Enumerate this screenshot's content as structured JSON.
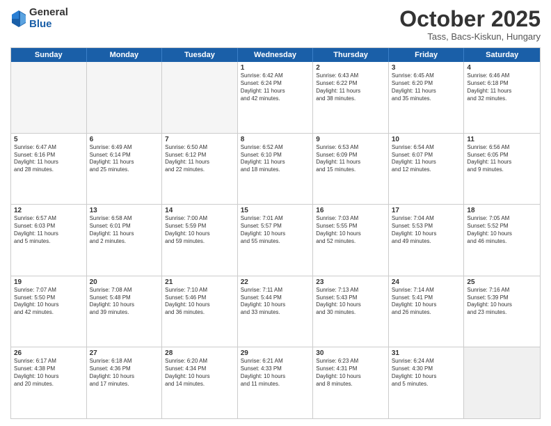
{
  "header": {
    "logo": {
      "general": "General",
      "blue": "Blue"
    },
    "title": "October 2025",
    "subtitle": "Tass, Bacs-Kiskun, Hungary"
  },
  "weekdays": [
    "Sunday",
    "Monday",
    "Tuesday",
    "Wednesday",
    "Thursday",
    "Friday",
    "Saturday"
  ],
  "rows": [
    [
      {
        "num": "",
        "text": "",
        "empty": true
      },
      {
        "num": "",
        "text": "",
        "empty": true
      },
      {
        "num": "",
        "text": "",
        "empty": true
      },
      {
        "num": "1",
        "text": "Sunrise: 6:42 AM\nSunset: 6:24 PM\nDaylight: 11 hours\nand 42 minutes."
      },
      {
        "num": "2",
        "text": "Sunrise: 6:43 AM\nSunset: 6:22 PM\nDaylight: 11 hours\nand 38 minutes."
      },
      {
        "num": "3",
        "text": "Sunrise: 6:45 AM\nSunset: 6:20 PM\nDaylight: 11 hours\nand 35 minutes."
      },
      {
        "num": "4",
        "text": "Sunrise: 6:46 AM\nSunset: 6:18 PM\nDaylight: 11 hours\nand 32 minutes."
      }
    ],
    [
      {
        "num": "5",
        "text": "Sunrise: 6:47 AM\nSunset: 6:16 PM\nDaylight: 11 hours\nand 28 minutes."
      },
      {
        "num": "6",
        "text": "Sunrise: 6:49 AM\nSunset: 6:14 PM\nDaylight: 11 hours\nand 25 minutes."
      },
      {
        "num": "7",
        "text": "Sunrise: 6:50 AM\nSunset: 6:12 PM\nDaylight: 11 hours\nand 22 minutes."
      },
      {
        "num": "8",
        "text": "Sunrise: 6:52 AM\nSunset: 6:10 PM\nDaylight: 11 hours\nand 18 minutes."
      },
      {
        "num": "9",
        "text": "Sunrise: 6:53 AM\nSunset: 6:09 PM\nDaylight: 11 hours\nand 15 minutes."
      },
      {
        "num": "10",
        "text": "Sunrise: 6:54 AM\nSunset: 6:07 PM\nDaylight: 11 hours\nand 12 minutes."
      },
      {
        "num": "11",
        "text": "Sunrise: 6:56 AM\nSunset: 6:05 PM\nDaylight: 11 hours\nand 9 minutes."
      }
    ],
    [
      {
        "num": "12",
        "text": "Sunrise: 6:57 AM\nSunset: 6:03 PM\nDaylight: 11 hours\nand 5 minutes."
      },
      {
        "num": "13",
        "text": "Sunrise: 6:58 AM\nSunset: 6:01 PM\nDaylight: 11 hours\nand 2 minutes."
      },
      {
        "num": "14",
        "text": "Sunrise: 7:00 AM\nSunset: 5:59 PM\nDaylight: 10 hours\nand 59 minutes."
      },
      {
        "num": "15",
        "text": "Sunrise: 7:01 AM\nSunset: 5:57 PM\nDaylight: 10 hours\nand 55 minutes."
      },
      {
        "num": "16",
        "text": "Sunrise: 7:03 AM\nSunset: 5:55 PM\nDaylight: 10 hours\nand 52 minutes."
      },
      {
        "num": "17",
        "text": "Sunrise: 7:04 AM\nSunset: 5:53 PM\nDaylight: 10 hours\nand 49 minutes."
      },
      {
        "num": "18",
        "text": "Sunrise: 7:05 AM\nSunset: 5:52 PM\nDaylight: 10 hours\nand 46 minutes."
      }
    ],
    [
      {
        "num": "19",
        "text": "Sunrise: 7:07 AM\nSunset: 5:50 PM\nDaylight: 10 hours\nand 42 minutes."
      },
      {
        "num": "20",
        "text": "Sunrise: 7:08 AM\nSunset: 5:48 PM\nDaylight: 10 hours\nand 39 minutes."
      },
      {
        "num": "21",
        "text": "Sunrise: 7:10 AM\nSunset: 5:46 PM\nDaylight: 10 hours\nand 36 minutes."
      },
      {
        "num": "22",
        "text": "Sunrise: 7:11 AM\nSunset: 5:44 PM\nDaylight: 10 hours\nand 33 minutes."
      },
      {
        "num": "23",
        "text": "Sunrise: 7:13 AM\nSunset: 5:43 PM\nDaylight: 10 hours\nand 30 minutes."
      },
      {
        "num": "24",
        "text": "Sunrise: 7:14 AM\nSunset: 5:41 PM\nDaylight: 10 hours\nand 26 minutes."
      },
      {
        "num": "25",
        "text": "Sunrise: 7:16 AM\nSunset: 5:39 PM\nDaylight: 10 hours\nand 23 minutes."
      }
    ],
    [
      {
        "num": "26",
        "text": "Sunrise: 6:17 AM\nSunset: 4:38 PM\nDaylight: 10 hours\nand 20 minutes."
      },
      {
        "num": "27",
        "text": "Sunrise: 6:18 AM\nSunset: 4:36 PM\nDaylight: 10 hours\nand 17 minutes."
      },
      {
        "num": "28",
        "text": "Sunrise: 6:20 AM\nSunset: 4:34 PM\nDaylight: 10 hours\nand 14 minutes."
      },
      {
        "num": "29",
        "text": "Sunrise: 6:21 AM\nSunset: 4:33 PM\nDaylight: 10 hours\nand 11 minutes."
      },
      {
        "num": "30",
        "text": "Sunrise: 6:23 AM\nSunset: 4:31 PM\nDaylight: 10 hours\nand 8 minutes."
      },
      {
        "num": "31",
        "text": "Sunrise: 6:24 AM\nSunset: 4:30 PM\nDaylight: 10 hours\nand 5 minutes."
      },
      {
        "num": "",
        "text": "",
        "empty": true,
        "shaded": true
      }
    ]
  ]
}
